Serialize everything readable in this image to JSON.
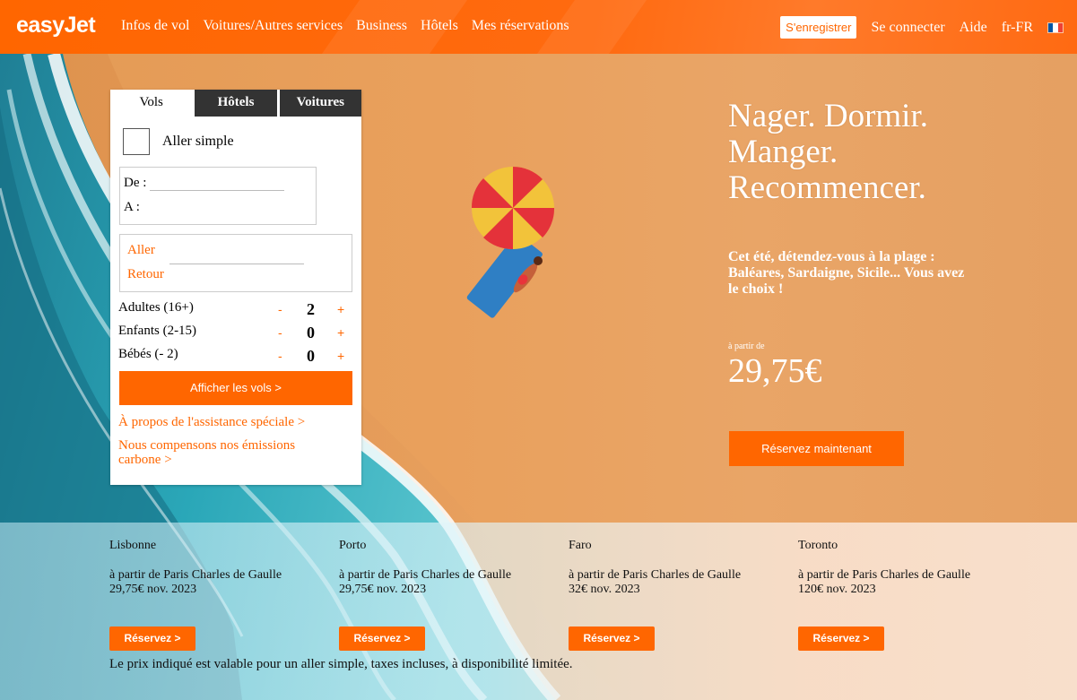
{
  "header": {
    "logo": "easyJet",
    "nav": [
      "Infos de vol",
      "Voitures/Autres services",
      "Business",
      "Hôtels",
      "Mes réservations"
    ],
    "register": "S'enregistrer",
    "login": "Se connecter",
    "help": "Aide",
    "locale": "fr-FR",
    "flag_icon": "france-flag-icon",
    "accent_color": "#ff6600"
  },
  "widget": {
    "tabs": [
      "Vols",
      "Hôtels",
      "Voitures"
    ],
    "one_way_label": "Aller simple",
    "from_label": "De :",
    "to_label": "A :",
    "depart_label": "Aller",
    "return_label": "Retour",
    "passengers": [
      {
        "label": "Adultes (16+)",
        "count": "2"
      },
      {
        "label": "Enfants (2-15)",
        "count": "0"
      },
      {
        "label": "Bébés (- 2)",
        "count": "0"
      }
    ],
    "minus": "-",
    "plus": "+",
    "show_flights": "Afficher les vols >",
    "assist_link": "À propos de l'assistance spéciale >",
    "carbon_link_1": "Nous compensons nos émissions",
    "carbon_link_2": "carbone >"
  },
  "hero": {
    "headline": [
      "Nager. Dormir.",
      "Manger.",
      "Recommencer."
    ],
    "subtext": "Cet été, détendez-vous à la plage : Baléares, Sardaigne, Sicile... Vous avez le choix !",
    "from_label": "à partir de",
    "price": "29,75€",
    "cta": "Réservez maintenant"
  },
  "destinations": [
    {
      "city": "Lisbonne",
      "origin": "à partir de Paris Charles de Gaulle",
      "price_date": "29,75€ nov. 2023",
      "cta": "Réservez >"
    },
    {
      "city": "Porto",
      "origin": "à partir de Paris Charles de Gaulle",
      "price_date": "29,75€ nov. 2023",
      "cta": "Réservez >"
    },
    {
      "city": "Faro",
      "origin": "à partir de Paris Charles de Gaulle",
      "price_date": "32€ nov. 2023",
      "cta": "Réservez >"
    },
    {
      "city": "Toronto",
      "origin": "à partir de Paris Charles de Gaulle",
      "price_date": "120€ nov. 2023",
      "cta": "Réservez >"
    }
  ],
  "disclaimer": "Le prix indiqué est valable pour un aller simple, taxes incluses, à disponibilité limitée."
}
